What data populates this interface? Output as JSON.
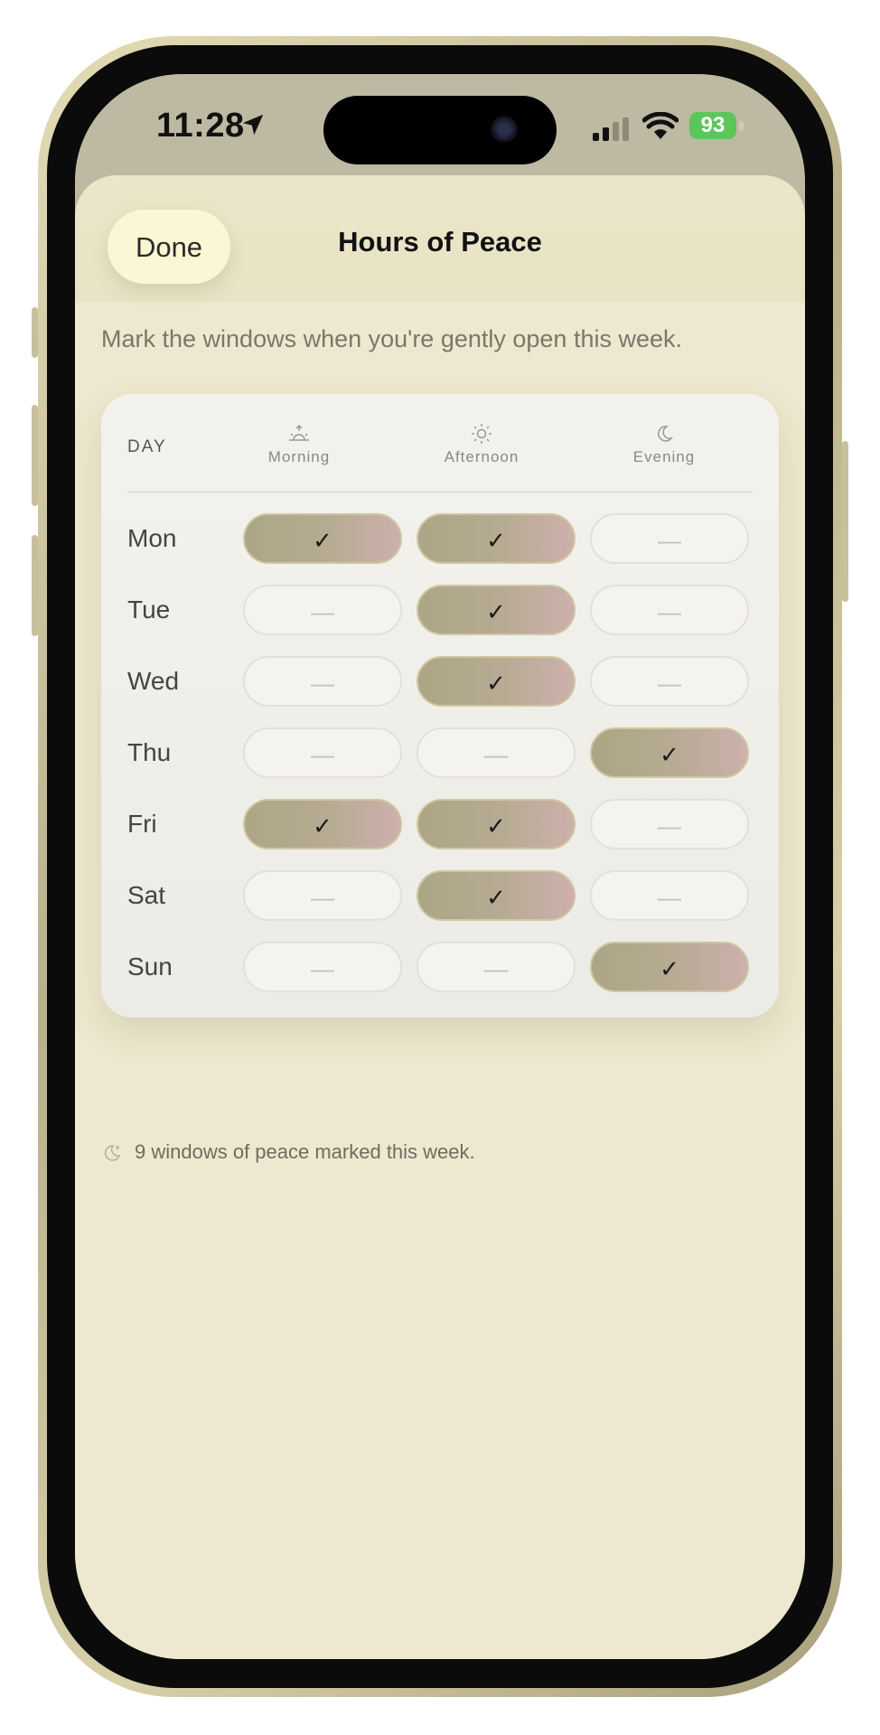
{
  "status_bar": {
    "time": "11:28",
    "battery": "93",
    "icons": [
      "location-arrow-icon",
      "signal-icon",
      "wifi-icon",
      "battery-icon"
    ]
  },
  "header": {
    "done_label": "Done",
    "title": "Hours of Peace"
  },
  "subtitle": "Mark the windows when you're gently open this week.",
  "grid": {
    "day_header": "DAY",
    "columns": [
      {
        "label": "Morning",
        "icon": "sunrise-icon"
      },
      {
        "label": "Afternoon",
        "icon": "sun-icon"
      },
      {
        "label": "Evening",
        "icon": "moon-icon"
      }
    ],
    "check_symbol": "✓",
    "empty_symbol": "—",
    "rows": [
      {
        "day": "Mon",
        "slots": [
          true,
          true,
          false
        ]
      },
      {
        "day": "Tue",
        "slots": [
          false,
          true,
          false
        ]
      },
      {
        "day": "Wed",
        "slots": [
          false,
          true,
          false
        ]
      },
      {
        "day": "Thu",
        "slots": [
          false,
          false,
          true
        ]
      },
      {
        "day": "Fri",
        "slots": [
          true,
          true,
          false
        ]
      },
      {
        "day": "Sat",
        "slots": [
          false,
          true,
          false
        ]
      },
      {
        "day": "Sun",
        "slots": [
          false,
          false,
          true
        ]
      }
    ]
  },
  "footer": {
    "icon": "moon-sparkle-icon",
    "text": "9 windows of peace marked this week."
  },
  "colors": {
    "sheet_bg": "#ede8cf",
    "done_button_bg": "#fbf6d4",
    "slot_on_start": "#aba686",
    "slot_on_end": "#cdb0ad",
    "slot_off": "#f4f3ee",
    "battery_green": "#5cc65a"
  }
}
